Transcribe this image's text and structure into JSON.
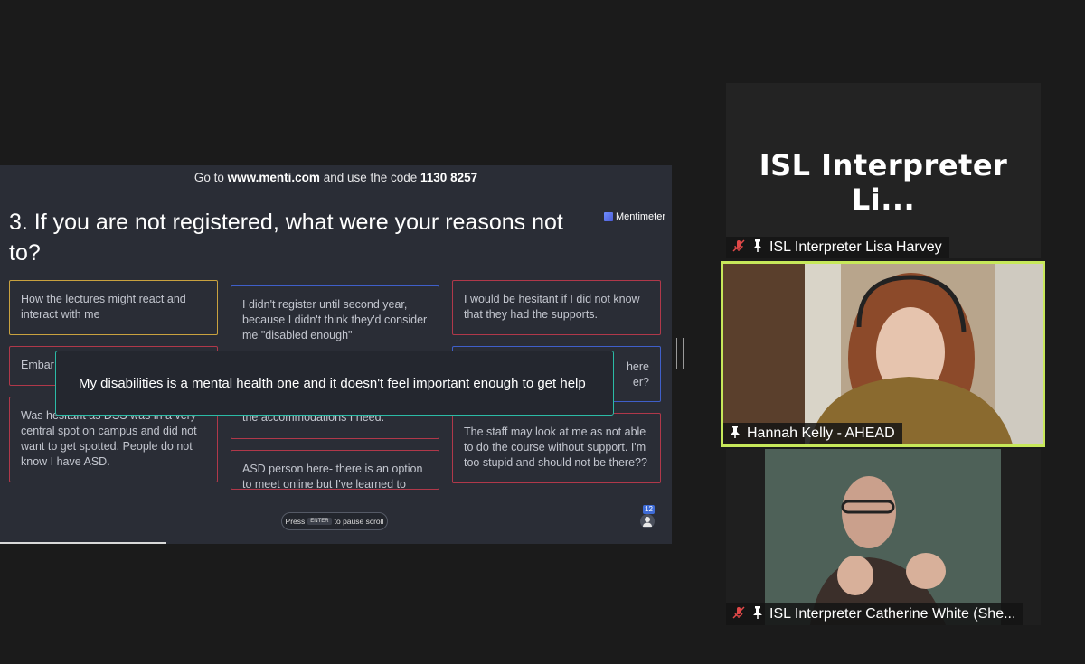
{
  "slide": {
    "instruction_prefix": "Go to ",
    "instruction_site": "www.menti.com",
    "instruction_mid": " and use the code ",
    "instruction_code": "1130 8257",
    "question": "3. If you are not registered, what were your reasons not to?",
    "logo": "Mentimeter",
    "cards": [
      {
        "text": "How the lectures might react and interact with me",
        "color": "#c9a23f"
      },
      {
        "text": "I didn't register until second year, because I didn't think they'd consider me \"disabled enough\"",
        "color": "#3f5fc9"
      },
      {
        "text": "I would be hesitant if I did not know that they had the supports.",
        "color": "#b0384a"
      },
      {
        "text": "Embar",
        "color": "#b0384a"
      },
      {
        "text": "here",
        "color": "#3f5fc9"
      },
      {
        "text": "er?",
        "color": "#3f5fc9"
      },
      {
        "text": "Was hesitant as DSS was in a very central spot on campus and did not want to get spotted. People do not know I have ASD.",
        "color": "#b0384a"
      },
      {
        "text": "the accommodations I need.",
        "color": "#b0384a"
      },
      {
        "text": "The staff may look at me as not able to do the course without support. I'm too stupid and should not be there??",
        "color": "#b0384a"
      },
      {
        "text": "ASD person here- there is an option to meet online but I've learned to adapt",
        "color": "#b0384a"
      }
    ],
    "popup": "My disabilities is a mental health one and it doesn't feel important enough to get help",
    "enter_hint_prefix": "Press",
    "enter_key": "ENTER",
    "enter_hint_suffix": "to pause scroll",
    "participant_count": "12"
  },
  "tiles": {
    "lisa": {
      "big_label": "ISL Interpreter Li...",
      "name": "ISL Interpreter Lisa Harvey"
    },
    "hannah": {
      "name": "Hannah Kelly - AHEAD"
    },
    "catherine": {
      "name": "ISL Interpreter Catherine White (She..."
    }
  },
  "colors": {
    "active_speaker_border": "#c7e85a",
    "popup_border": "#2bbba6",
    "muted_icon": "#e04848"
  }
}
